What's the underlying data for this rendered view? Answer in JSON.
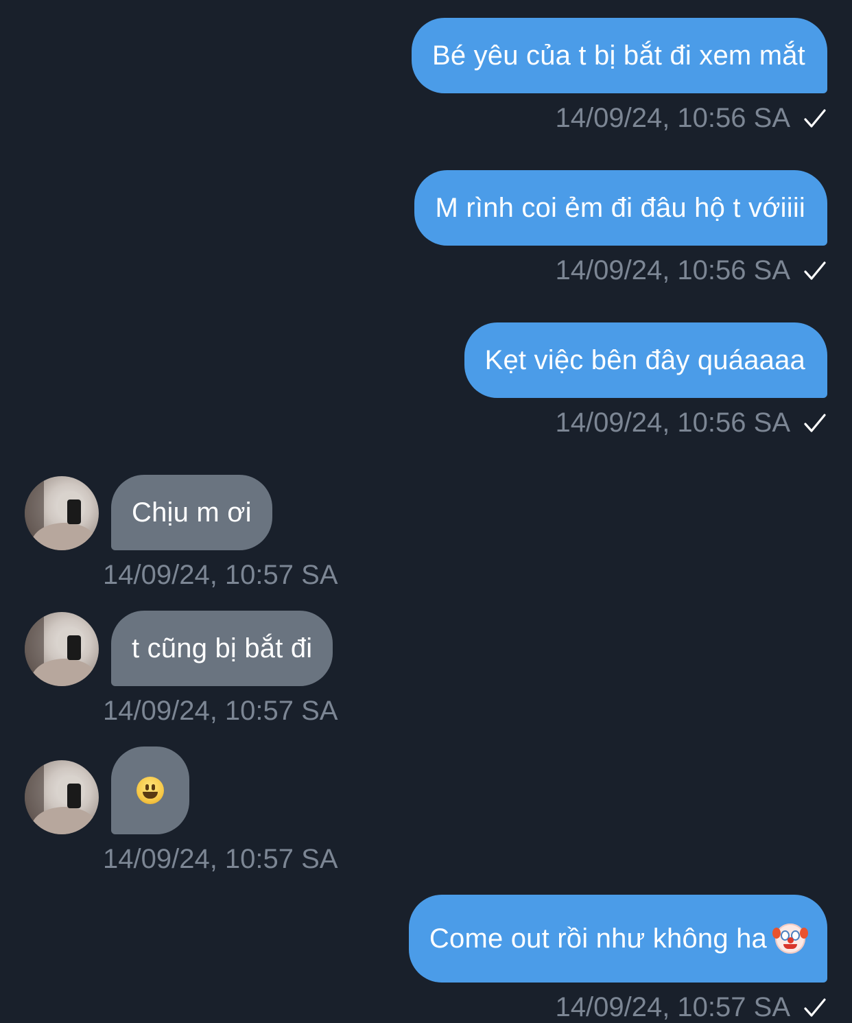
{
  "conversation": {
    "messages": [
      {
        "direction": "outgoing",
        "text": "Bé yêu của t bị bắt đi xem mắt",
        "time": "14/09/24, 10:56 SA",
        "status_icon": "check-icon"
      },
      {
        "direction": "outgoing",
        "text": "M rình coi ẻm đi đâu hộ t vớiiii",
        "time": "14/09/24, 10:56 SA",
        "status_icon": "check-icon"
      },
      {
        "direction": "outgoing",
        "text": "Kẹt việc bên đây quáaaaa",
        "time": "14/09/24, 10:56 SA",
        "status_icon": "check-icon"
      },
      {
        "direction": "incoming",
        "text": "Chịu m ơi",
        "time": "14/09/24, 10:57 SA",
        "avatar_icon": "avatar-photo"
      },
      {
        "direction": "incoming",
        "text": "t cũng bị bắt đi",
        "time": "14/09/24, 10:57 SA",
        "avatar_icon": "avatar-photo"
      },
      {
        "direction": "incoming",
        "text": "",
        "emoji": "smiling-face-emoji",
        "time": "14/09/24, 10:57 SA",
        "avatar_icon": "avatar-photo"
      },
      {
        "direction": "outgoing",
        "text": "Come out rồi như không ha",
        "emoji": "clown-face-emoji",
        "time": "14/09/24, 10:57 SA",
        "status_icon": "check-icon"
      }
    ]
  },
  "colors": {
    "background": "#19202b",
    "outgoing_bubble": "#4b9ce8",
    "incoming_bubble": "#6a7480",
    "timestamp": "#7c8694",
    "text": "#ffffff"
  }
}
